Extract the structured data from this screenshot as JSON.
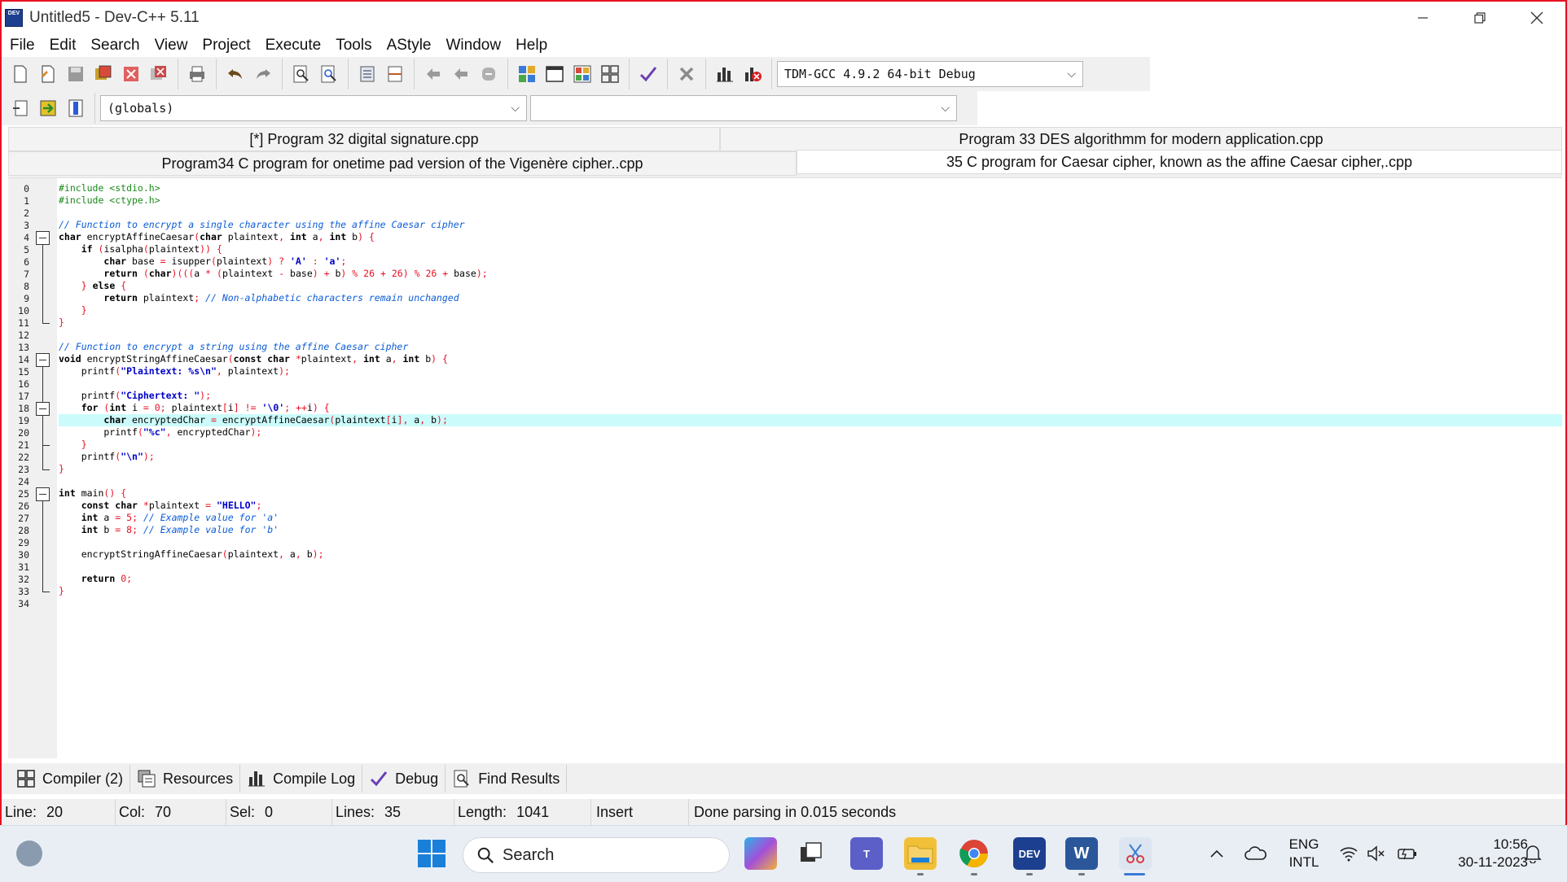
{
  "window": {
    "title": "Untitled5 - Dev-C++ 5.11",
    "controls": [
      "minimize-icon",
      "restore-icon",
      "close-icon"
    ]
  },
  "menu": [
    "File",
    "Edit",
    "Search",
    "View",
    "Project",
    "Execute",
    "Tools",
    "AStyle",
    "Window",
    "Help"
  ],
  "toolbar": {
    "compiler_select": "TDM-GCC 4.9.2 64-bit Debug",
    "scope_select": "(globals)",
    "function_select": ""
  },
  "tabs": {
    "row1": [
      "[*] Program 32 digital signature.cpp",
      "Program 33 DES algorithmm for modern application.cpp"
    ],
    "row2": [
      "Program34 C program for onetime pad version of the Vigenère cipher..cpp",
      "35 C program for Caesar cipher, known as the affine Caesar cipher,.cpp"
    ]
  },
  "editor": {
    "line_numbers": [
      "0",
      "1",
      "2",
      "3",
      "4",
      "5",
      "6",
      "7",
      "8",
      "9",
      "10",
      "11",
      "12",
      "13",
      "14",
      "15",
      "16",
      "17",
      "18",
      "19",
      "20",
      "21",
      "22",
      "23",
      "24",
      "25",
      "26",
      "27",
      "28",
      "29",
      "30",
      "31",
      "32",
      "33",
      "34"
    ],
    "highlighted_line": 19,
    "code": [
      "#include <stdio.h>",
      "#include <ctype.h>",
      "",
      "// Function to encrypt a single character using the affine Caesar cipher",
      "char encryptAffineCaesar(char plaintext, int a, int b) {",
      "    if (isalpha(plaintext)) {",
      "        char base = isupper(plaintext) ? 'A' : 'a';",
      "        return (char)(((a * (plaintext - base) + b) % 26 + 26) % 26 + base);",
      "    } else {",
      "        return plaintext; // Non-alphabetic characters remain unchanged",
      "    }",
      "}",
      "",
      "// Function to encrypt a string using the affine Caesar cipher",
      "void encryptStringAffineCaesar(const char *plaintext, int a, int b) {",
      "    printf(\"Plaintext: %s\\n\", plaintext);",
      "",
      "    printf(\"Ciphertext: \");",
      "    for (int i = 0; plaintext[i] != '\\0'; ++i) {",
      "        char encryptedChar = encryptAffineCaesar(plaintext[i], a, b);",
      "        printf(\"%c\", encryptedChar);",
      "    }",
      "    printf(\"\\n\");",
      "}",
      "",
      "int main() {",
      "    const char *plaintext = \"HELLO\";",
      "    int a = 5; // Example value for 'a'",
      "    int b = 8; // Example value for 'b'",
      "",
      "    encryptStringAffineCaesar(plaintext, a, b);",
      "",
      "    return 0;",
      "}",
      ""
    ]
  },
  "bottom_tabs": [
    {
      "label": "Compiler (2)",
      "icon": "grid-icon"
    },
    {
      "label": "Resources",
      "icon": "resources-icon"
    },
    {
      "label": "Compile Log",
      "icon": "chart-icon"
    },
    {
      "label": "Debug",
      "icon": "check-icon"
    },
    {
      "label": "Find Results",
      "icon": "find-icon"
    }
  ],
  "status": {
    "line_label": "Line:",
    "line_value": "20",
    "col_label": "Col:",
    "col_value": "70",
    "sel_label": "Sel:",
    "sel_value": "0",
    "lines_label": "Lines:",
    "lines_value": "35",
    "length_label": "Length:",
    "length_value": "1041",
    "mode": "Insert",
    "message": "Done parsing in 0.015 seconds"
  },
  "taskbar": {
    "search_placeholder": "Search",
    "apps": [
      "windows-start-icon",
      "copilot-icon",
      "task-view-icon",
      "teams-icon",
      "file-explorer-icon",
      "chrome-icon",
      "devcpp-icon",
      "word-icon",
      "snipping-tool-icon"
    ],
    "dev_label": "DEV",
    "word_label": "W",
    "lang_line1": "ENG",
    "lang_line2": "INTL",
    "time": "10:56",
    "date": "30-11-2023"
  },
  "colors": {
    "keyword": "#000000",
    "comment": "#0b5cd6",
    "string": "#0000cc",
    "number": "#e81123",
    "preprocessor": "#1a8a1a",
    "highlight_line": "#ccfbfb",
    "window_border": "#e81123"
  }
}
